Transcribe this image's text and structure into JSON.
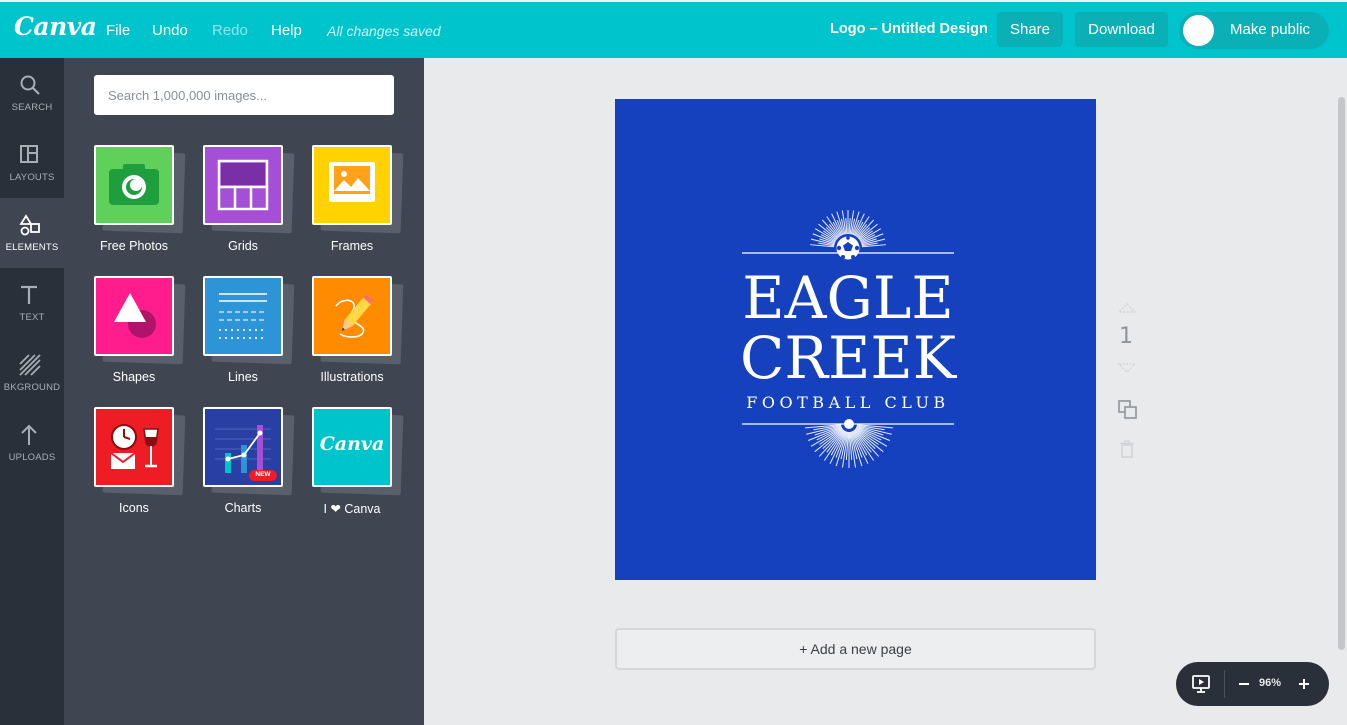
{
  "colors": {
    "topbar": "#00c4cc",
    "rail": "#293039",
    "panel": "#3f4652",
    "design_bg": "#1541bf"
  },
  "topbar": {
    "logo": "Canva",
    "menu": [
      "File",
      "Undo",
      "Redo",
      "Help"
    ],
    "save_status": "All changes saved",
    "doc_title": "Logo – Untitled Design",
    "share_label": "Share",
    "download_label": "Download",
    "make_public_label": "Make public"
  },
  "rail": {
    "items": [
      {
        "label": "SEARCH",
        "icon": "search-icon"
      },
      {
        "label": "LAYOUTS",
        "icon": "layout-icon"
      },
      {
        "label": "ELEMENTS",
        "icon": "shapes-icon",
        "active": true
      },
      {
        "label": "TEXT",
        "icon": "text-icon"
      },
      {
        "label": "BKGROUND",
        "icon": "background-icon"
      },
      {
        "label": "UPLOADS",
        "icon": "upload-icon"
      }
    ]
  },
  "panel": {
    "search_placeholder": "Search 1,000,000 images...",
    "tiles": [
      {
        "label": "Free Photos",
        "icon": "camera-icon",
        "color": "#5fd05a"
      },
      {
        "label": "Grids",
        "icon": "grid-icon",
        "color": "#a64fd6"
      },
      {
        "label": "Frames",
        "icon": "frame-icon",
        "color": "#ffd200"
      },
      {
        "label": "Shapes",
        "icon": "triangle-circle-icon",
        "color": "#ff1d8e"
      },
      {
        "label": "Lines",
        "icon": "lines-icon",
        "color": "#2e94d8"
      },
      {
        "label": "Illustrations",
        "icon": "pencil-icon",
        "color": "#ff8c00"
      },
      {
        "label": "Icons",
        "icon": "clock-glass-icon",
        "color": "#ee1c24"
      },
      {
        "label": "Charts",
        "icon": "chart-icon",
        "color": "#2a3fa4",
        "badge": "NEW"
      },
      {
        "label": "I ❤ Canva",
        "icon": "canva-logo-icon",
        "color": "#00c4cc",
        "logo_text": "Canva"
      }
    ]
  },
  "design": {
    "line1": "EAGLE",
    "line2": "CREEK",
    "line3": "FOOTBALL CLUB"
  },
  "page_number": "1",
  "add_page_label": "+ Add a new page",
  "zoom": {
    "value": "96%"
  }
}
